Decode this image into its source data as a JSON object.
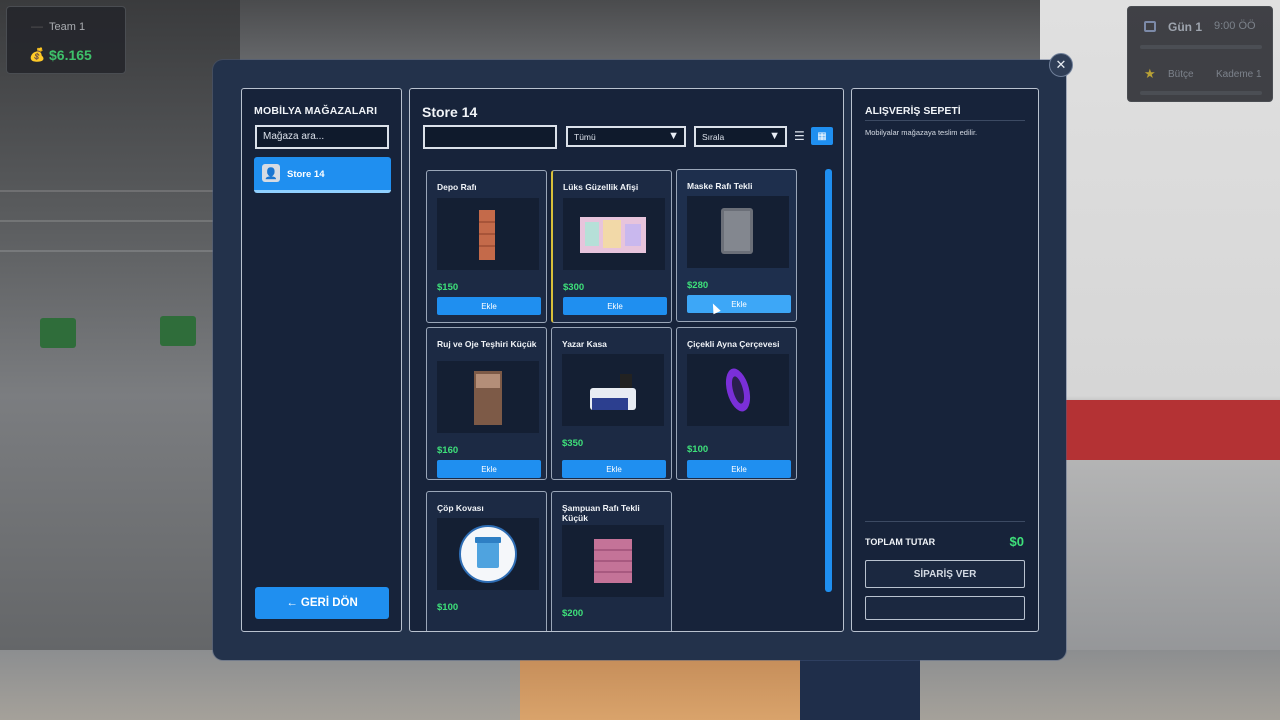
{
  "hud": {
    "team_name": "Team 1",
    "money": "$6.165",
    "day": "Gün 1",
    "time": "9:00 ÖÖ",
    "budget_label": "Bütçe",
    "level_label": "Kademe 1"
  },
  "sidebar": {
    "heading": "MOBİLYA MAĞAZALARI",
    "search_placeholder": "Mağaza ara...",
    "stores": [
      {
        "label": "Store 14"
      }
    ],
    "back_label": "← GERİ DÖN"
  },
  "catalog": {
    "title": "Store 14",
    "filter_placeholder": "",
    "category_selected": "Tümü",
    "sort_selected": "Sırala",
    "add_label": "Ekle",
    "items": [
      {
        "name": "Depo Rafı",
        "price": "$150"
      },
      {
        "name": "Lüks Güzellik Afişi",
        "price": "$300"
      },
      {
        "name": "Maske Rafı Tekli",
        "price": "$280"
      },
      {
        "name": "Ruj ve Oje Teşhiri Küçük",
        "price": "$160"
      },
      {
        "name": "Yazar Kasa",
        "price": "$350"
      },
      {
        "name": "Çiçekli Ayna Çerçevesi",
        "price": "$100"
      },
      {
        "name": "Çöp Kovası",
        "price": "$100"
      },
      {
        "name": "Şampuan Rafı Tekli Küçük",
        "price": "$200"
      }
    ]
  },
  "cart": {
    "heading": "ALIŞVERİŞ SEPETİ",
    "note": "Mobilyalar mağazaya teslim edilir.",
    "total_label": "TOPLAM TUTAR",
    "total_value": "$0",
    "order_label": "SİPARİŞ VER"
  },
  "colors": {
    "accent": "#1f8ff0",
    "price": "#3ee07a",
    "panel": "#17233a",
    "modal": "#23324b"
  }
}
